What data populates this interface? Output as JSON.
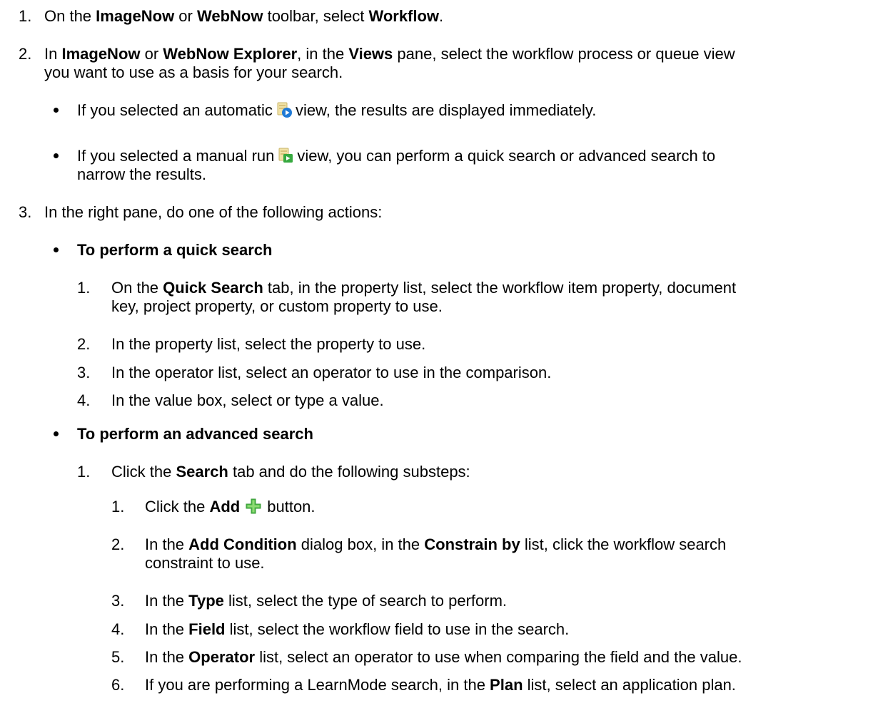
{
  "steps": {
    "s1": {
      "num": "1.",
      "a": "On the ",
      "b1": "ImageNow",
      "c": " or ",
      "b2": "WebNow",
      "d": " toolbar, select ",
      "b3": "Workflow",
      "e": "."
    },
    "s2": {
      "num": "2.",
      "a": "In ",
      "b1": "ImageNow",
      "c": " or ",
      "b2": "WebNow Explorer",
      "d": ", in the ",
      "b3": "Views",
      "e": " pane, select the workflow process or queue view",
      "line2": "you want to use as a basis for your search.",
      "bullet1": {
        "a": "If you selected an automatic",
        "b": "view, the results are displayed immediately.",
        "icon": "automatic-view-icon"
      },
      "bullet2": {
        "a": "If you selected a manual run",
        "b": "view, you can perform a quick search or advanced search to",
        "line2": "narrow the results.",
        "icon": "manual-run-view-icon"
      }
    },
    "s3": {
      "num": "3.",
      "text": "In the right pane, do one of the following actions:",
      "quick": {
        "heading": "To perform a quick search",
        "items": [
          {
            "num": "1.",
            "a": "On the ",
            "b": "Quick Search",
            "c": " tab, in the property list, select the workflow item property, document",
            "line2": "key, project property, or custom property to use."
          },
          {
            "num": "2.",
            "text": "In the property list, select the property to use."
          },
          {
            "num": "3.",
            "text": "In the operator list, select an operator to use in the comparison."
          },
          {
            "num": "4.",
            "text": "In the value box, select or type a value."
          }
        ]
      },
      "advanced": {
        "heading": "To perform an advanced search",
        "step1": {
          "num": "1.",
          "a": "Click the ",
          "b": "Search",
          "c": " tab and do the following substeps:"
        },
        "sub": [
          {
            "num": "1.",
            "a": "Click the ",
            "b": "Add",
            "c": "button.",
            "icon": "add-plus-icon"
          },
          {
            "num": "2.",
            "a": "In the ",
            "b1": "Add Condition",
            "c": " dialog box, in the ",
            "b2": "Constrain by",
            "d": " list, click the workflow search",
            "line2": "constraint to use."
          },
          {
            "num": "3.",
            "a": "In the ",
            "b": "Type",
            "c": " list, select the type of search to perform."
          },
          {
            "num": "4.",
            "a": "In the ",
            "b": "Field",
            "c": " list, select the workflow field to use in the search."
          },
          {
            "num": "5.",
            "a": "In the ",
            "b": "Operator",
            "c": " list, select an operator to use when comparing the field and the value."
          },
          {
            "num": "6.",
            "a": "If you are performing a LearnMode search, in the ",
            "b": "Plan",
            "c": " list, select an application plan."
          }
        ]
      }
    }
  },
  "colors": {
    "text": "#000000",
    "add_icon": "#4cb848"
  }
}
